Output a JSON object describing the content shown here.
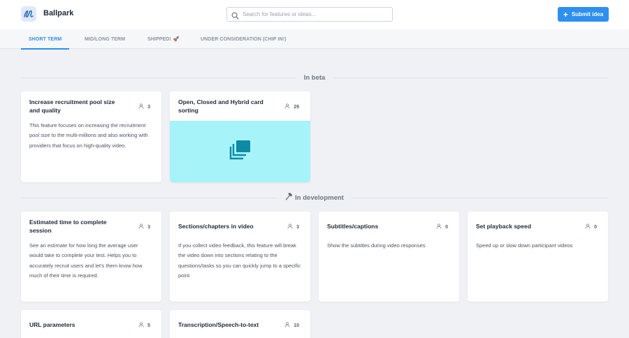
{
  "app": {
    "name": "Ballpark",
    "logo_icon": "ballpark-logo-icon"
  },
  "search": {
    "placeholder": "Search for features or ideas...",
    "value": ""
  },
  "submit_button": {
    "label": "Submit idea",
    "color": "#2d8ff0"
  },
  "tabs": [
    {
      "label": "SHORT TERM",
      "active": true
    },
    {
      "label": "MID/LONG TERM",
      "active": false
    },
    {
      "label": "SHIPPED!",
      "suffix": "🚀",
      "active": false
    },
    {
      "label": "UNDER CONSIDERATION (CHIP IN!)",
      "active": false
    }
  ],
  "sections": [
    {
      "title": "In beta",
      "cards": [
        {
          "title": "Increase recruitment pool size and quality",
          "votes": "3",
          "description": "This feature focuses on increasing the recruitment pool size to the multi-millions and also working with providers that focus on high-quality video."
        },
        {
          "title": "Open, Closed and Hybrid card sorting",
          "votes": "29",
          "media_icon": "card-stack-icon",
          "media_color": "#a7f3fa"
        }
      ]
    },
    {
      "title": "In development",
      "title_icon": "hammer-icon",
      "cards": [
        {
          "title": "Estimated time to complete session",
          "votes": "3",
          "description": "See an estimate for how long the average user would take to complete your test. Helps you to accurately recruit users and let's them know how much of their time is required."
        },
        {
          "title": "Sections/chapters in video",
          "votes": "3",
          "description": "If you collect video feedback, this feature will break the video down into sections relating to the questions/tasks so you can quickly jump to a specific point"
        },
        {
          "title": "Subtitles/captions",
          "votes": "0",
          "description": "Show the subtitles during video responses"
        },
        {
          "title": "Set playback speed",
          "votes": "0",
          "description": "Speed up or slow down participant videos"
        },
        {
          "title": "URL parameters",
          "votes": "5"
        },
        {
          "title": "Transcription/Speech-to-text",
          "votes": "10"
        }
      ]
    }
  ]
}
